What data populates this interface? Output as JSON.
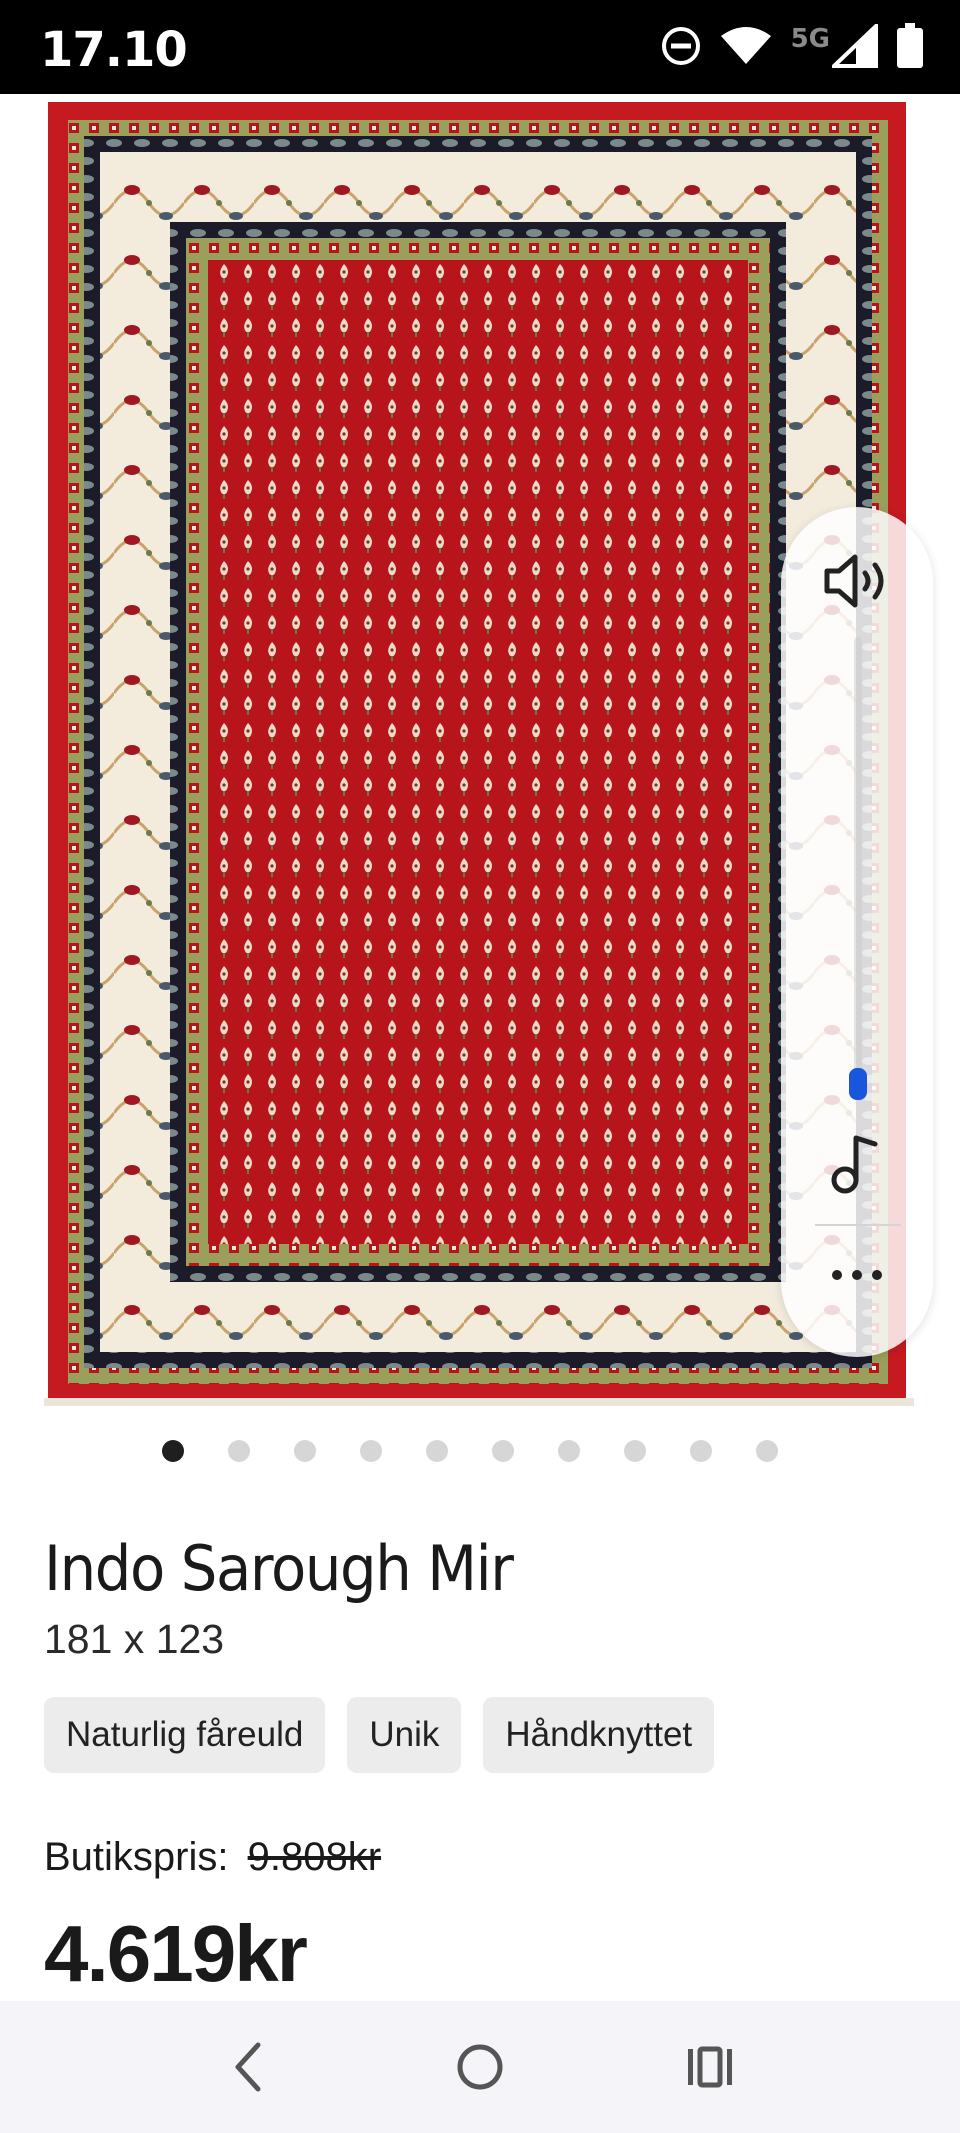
{
  "status_bar": {
    "time": "17.10",
    "network": "5G",
    "icons": [
      "do-not-disturb-icon",
      "wifi-icon",
      "signal-icon",
      "battery-icon"
    ]
  },
  "product": {
    "image_alt": "Indo Sarough Mir",
    "colors": {
      "field": "#b8141c",
      "border_cream": "#f3ecdd",
      "border_green": "#9aa05c",
      "border_dark": "#1b1b2a"
    },
    "carousel": {
      "total": 10,
      "active": 0
    },
    "title": "Indo Sarough Mir",
    "size": "181 x 123",
    "tags": [
      "Naturlig fåreuld",
      "Unik",
      "Håndknyttet"
    ],
    "store_price_label": "Butikspris:",
    "store_price_old": "9.808kr",
    "price": "4.619kr"
  },
  "volume_panel": {
    "icons": [
      "speaker-icon",
      "music-note-icon",
      "more-icon"
    ],
    "accent": "#1a56db"
  },
  "nav_bar": {
    "icons": [
      "back-icon",
      "home-icon",
      "recents-icon"
    ]
  }
}
